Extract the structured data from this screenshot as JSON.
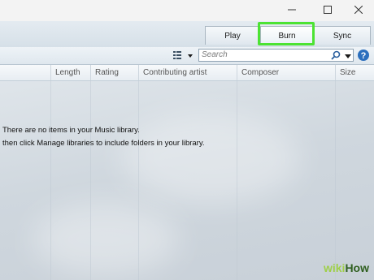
{
  "window": {
    "minimize_icon": "minimize-icon",
    "maximize_icon": "maximize-icon",
    "close_icon": "close-icon"
  },
  "tabs": [
    {
      "label": "Play"
    },
    {
      "label": "Burn"
    },
    {
      "label": "Sync"
    }
  ],
  "highlight_color": "#4ce333",
  "toolbar": {
    "view_options_icon": "view-options-icon",
    "search_placeholder": "Search",
    "search_icon": "search-icon"
  },
  "columns": [
    "Length",
    "Rating",
    "Contributing artist",
    "Composer",
    "Size"
  ],
  "message": {
    "line1": "There are no items in your Music library.",
    "line2": "then click Manage libraries to include folders in your library."
  },
  "watermark": {
    "wiki": "wiki",
    "how": "How"
  }
}
